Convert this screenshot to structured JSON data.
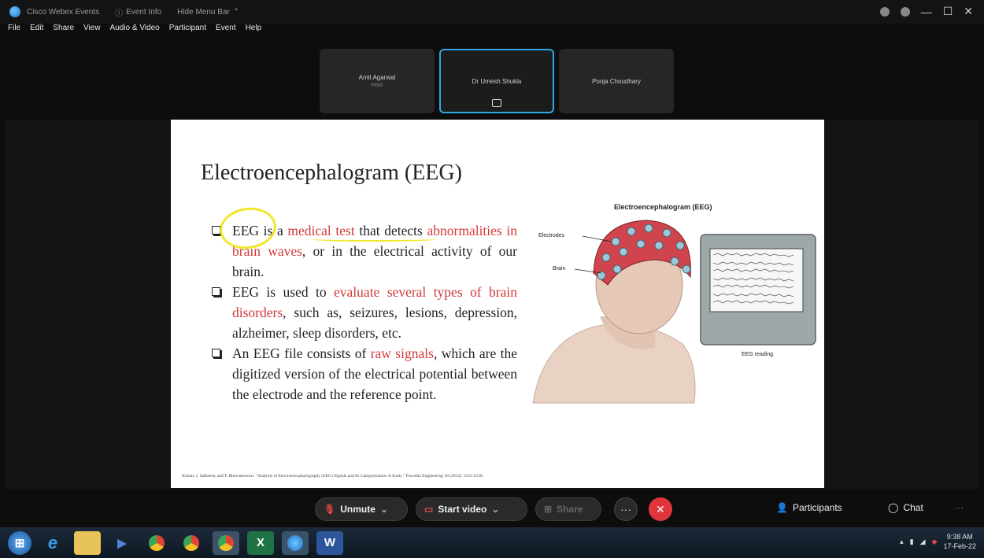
{
  "titlebar": {
    "app_name": "Cisco Webex Events",
    "event_info": "Event Info",
    "hide_menu": "Hide Menu Bar",
    "controls": [
      "—",
      "☐",
      "✕"
    ]
  },
  "menu": [
    "File",
    "Edit",
    "Share",
    "View",
    "Audio & Video",
    "Participant",
    "Event",
    "Help"
  ],
  "participants": [
    {
      "name": "Amit Agarwal",
      "role": "Host",
      "active": false
    },
    {
      "name": "Dr Umesh Shukla",
      "role": "",
      "active": true
    },
    {
      "name": "Pooja Choudhary",
      "role": "",
      "active": false
    }
  ],
  "slide": {
    "title": "Electroencephalogram (EEG)",
    "bullets": [
      [
        {
          "t": "EEG is a ",
          "c": ""
        },
        {
          "t": "medical test",
          "c": "red"
        },
        {
          "t": " that detects ",
          "c": ""
        },
        {
          "t": "abnormalities in brain waves",
          "c": "red"
        },
        {
          "t": ", or in the electrical activity of our brain.",
          "c": ""
        }
      ],
      [
        {
          "t": "EEG is used to ",
          "c": ""
        },
        {
          "t": "evaluate several types of brain disorders",
          "c": "red"
        },
        {
          "t": ", such as, seizures, lesions, depression, alzheimer, sleep disorders, etc.",
          "c": ""
        }
      ],
      [
        {
          "t": "An EEG file consists of ",
          "c": ""
        },
        {
          "t": "raw signals",
          "c": "red"
        },
        {
          "t": ", which are the digitized version of the electrical potential between the electrode and the reference point.",
          "c": ""
        }
      ]
    ],
    "footnote": "Kumar, J. Satheesh, and P. Bhuvaneswari. \"Analysis of Electroencephalography (EEG) Signals and Its Categorization–A Study.\" Procedia Engineering 38 (2012): 2525-2536.",
    "figure": {
      "title": "Electroencephalogram (EEG)",
      "electrodes_label": "Electrodes",
      "brain_label": "Brain",
      "reading_label": "EEG reading"
    }
  },
  "controls": {
    "unmute": "Unmute",
    "start_video": "Start video",
    "share": "Share",
    "more": "···",
    "participants": "Participants",
    "chat": "Chat",
    "overflow": "···"
  },
  "taskbar": {
    "apps": [
      "windows-start",
      "internet-explorer",
      "file-explorer",
      "media-player",
      "chrome",
      "chrome-2",
      "chrome-3",
      "excel",
      "webex",
      "word"
    ],
    "time": "9:38 AM",
    "date": "17-Feb-22"
  }
}
